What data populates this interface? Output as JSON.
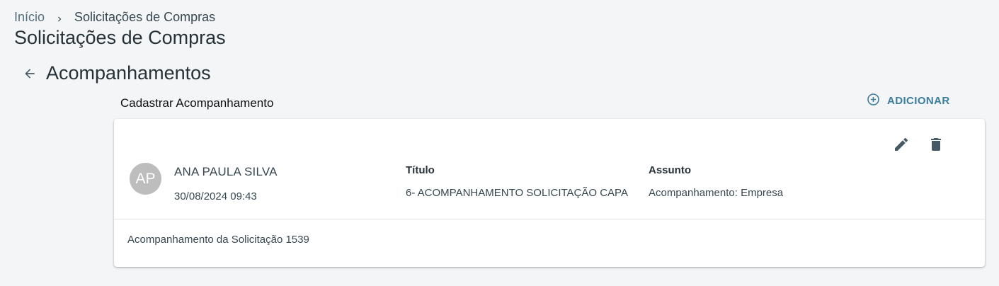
{
  "breadcrumb": {
    "home": "Início",
    "current": "Solicitações de Compras"
  },
  "page": {
    "title": "Solicitações de Compras"
  },
  "section": {
    "title": "Acompanhamentos",
    "subtitle": "Cadastrar Acompanhamento",
    "add_label": "ADICIONAR"
  },
  "card": {
    "avatar_initials": "AP",
    "user_name": "ANA PAULA SILVA",
    "date": "30/08/2024 09:43",
    "titulo_label": "Título",
    "titulo_value": "6- ACOMPANHAMENTO SOLICITAÇÃO CAPA",
    "assunto_label": "Assunto",
    "assunto_value": "Acompanhamento: Empresa",
    "body": "Acompanhamento da Solicitação 1539",
    "actions": [
      "edit-icon",
      "delete-icon"
    ]
  },
  "colors": {
    "background": "#f4f5f7",
    "accent": "#3b7d9c",
    "avatar_bg": "#bdbdbd",
    "icon": "#455a64"
  }
}
